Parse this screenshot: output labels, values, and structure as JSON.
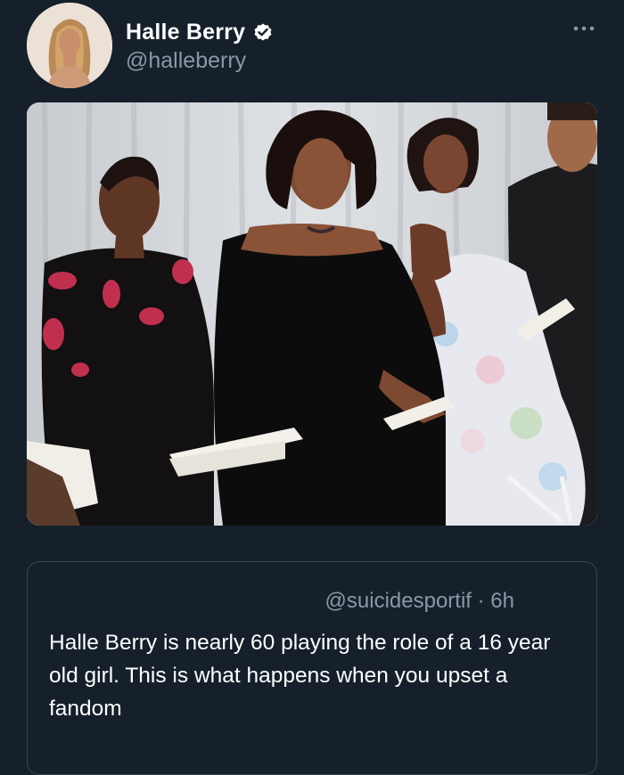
{
  "tweet": {
    "author_name": "Halle Berry",
    "author_handle": "@halleberry",
    "verified": true,
    "more_icon": "more-horizontal-icon",
    "avatar_alt": "profile photo"
  },
  "quoted_tweet": {
    "handle": "@suicidesportif",
    "separator": " · ",
    "time": "6h",
    "text": "Halle Berry is nearly 60 playing the role of a 16 year old girl. This is what happens when you upset a fandom"
  },
  "colors": {
    "background": "#15202b",
    "secondary_text": "#8899a6",
    "verified_blue": "#ffffff",
    "border": "#38444d"
  }
}
